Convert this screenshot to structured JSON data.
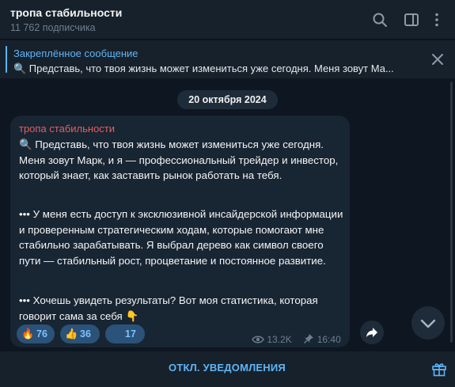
{
  "header": {
    "title": "тропа стабильности",
    "subscribers": "11 762 подписчика"
  },
  "pinned": {
    "label": "Закреплённое сообщение",
    "preview": "🔍 Представь, что твоя жизнь может измениться уже сегодня. Меня зовут Ма..."
  },
  "date_separator": "20 октября 2024",
  "message": {
    "author": "тропа стабильности",
    "paragraphs": [
      "🔍 Представь, что твоя жизнь может измениться уже сегодня. Меня зовут Марк, и я — профессиональный трейдер и инвестор, который знает, как заставить рынок работать на тебя.",
      "••• У меня есть доступ к эксклюзивной инсайдерской информации и проверенным стратегическим ходам, которые помогают мне стабильно зарабатывать. Я выбрал дерево как символ своего пути — стабильный рост, процветание и постоянное развитие.",
      "••• Хочешь увидеть результаты? Вот моя статистика, которая говорит сама за себя 👇"
    ],
    "reactions": [
      {
        "emoji": "🔥",
        "count": "76"
      },
      {
        "emoji": "👍",
        "count": "36"
      },
      {
        "emoji": "",
        "count": "17"
      }
    ],
    "views": "13.2K",
    "time": "16:40"
  },
  "bottom": {
    "mute_label": "ОТКЛ. УВЕДОМЛЕНИЯ"
  },
  "colors": {
    "accent": "#5eb5f7",
    "author": "#e35f63",
    "bubble": "#182533",
    "background": "#0e1621"
  }
}
